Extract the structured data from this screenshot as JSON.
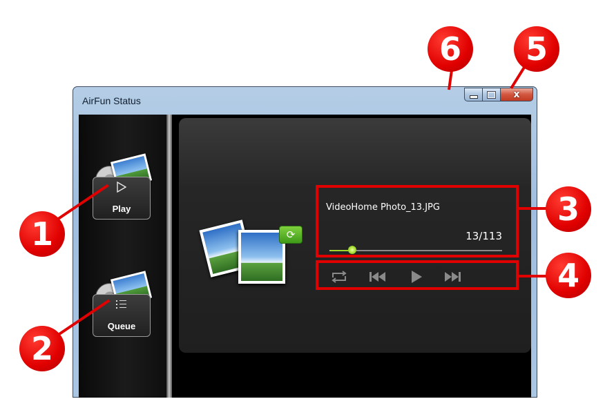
{
  "window": {
    "title": "AirFun Status",
    "caption_buttons": {
      "minimize": "minimize",
      "maximize": "maximize",
      "close": "x"
    }
  },
  "sidebar": {
    "items": [
      {
        "label": "Play",
        "icon": "play-icon"
      },
      {
        "label": "Queue",
        "icon": "list-icon"
      }
    ]
  },
  "now_playing": {
    "file_name": "VideoHome Photo_13.JPG",
    "counter": "13/113",
    "progress": 0.13
  },
  "controls": {
    "items": [
      "repeat-icon",
      "previous-icon",
      "play-icon",
      "next-icon"
    ]
  },
  "annotations": [
    "1",
    "2",
    "3",
    "4",
    "5",
    "6"
  ],
  "colors": {
    "accent_green": "#9fd82a",
    "annotation_red": "#e00000",
    "panel_bg": "#262626"
  }
}
